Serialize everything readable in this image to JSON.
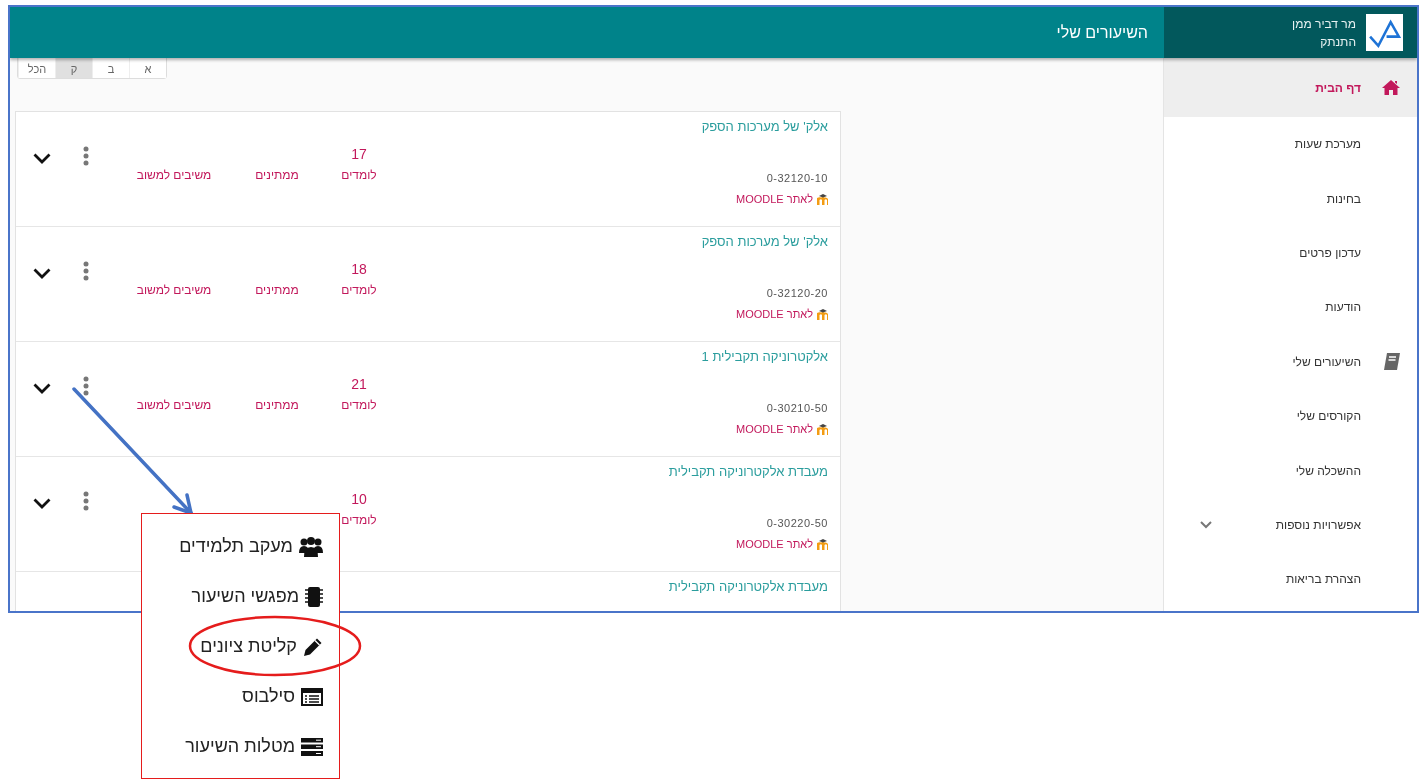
{
  "header": {
    "title": "השיעורים שלי",
    "user_name": "מר דביר ממן",
    "logout": "התנתק"
  },
  "filter_tabs": [
    {
      "label": "א",
      "selected": false
    },
    {
      "label": "ב",
      "selected": false
    },
    {
      "label": "ק",
      "selected": true
    },
    {
      "label": "הכל",
      "selected": false
    }
  ],
  "sidebar": {
    "items": [
      {
        "label": "דף הבית",
        "selected": true,
        "kind": "home"
      },
      {
        "label": "מערכת שעות",
        "selected": false,
        "kind": "plain"
      },
      {
        "label": "בחינות",
        "selected": false,
        "kind": "plain"
      },
      {
        "label": "עדכון פרטים",
        "selected": false,
        "kind": "plain"
      },
      {
        "label": "הודעות",
        "selected": false,
        "kind": "plain"
      },
      {
        "label": "השיעורים שלי",
        "selected": false,
        "kind": "book"
      },
      {
        "label": "הקורסים שלי",
        "selected": false,
        "kind": "plain"
      },
      {
        "label": "ההשכלה שלי",
        "selected": false,
        "kind": "plain"
      },
      {
        "label": "אפשרויות נוספות",
        "selected": false,
        "kind": "group",
        "expanded": false
      },
      {
        "label": "הצהרת בריאות",
        "selected": false,
        "kind": "plain"
      }
    ]
  },
  "courses": [
    {
      "title": "אלק' של מערכות הספק",
      "code": "0-32120-10",
      "moodle_link": "לאתר MOODLE",
      "students_count": "17",
      "students_label": "לומדים",
      "pending_label": "ממתינים",
      "feedback_label": "משיבים למשוב"
    },
    {
      "title": "אלק' של מערכות הספק",
      "code": "0-32120-20",
      "moodle_link": "לאתר MOODLE",
      "students_count": "18",
      "students_label": "לומדים",
      "pending_label": "ממתינים",
      "feedback_label": "משיבים למשוב"
    },
    {
      "title": "אלקטרוניקה תקבילית 1",
      "code": "0-30210-50",
      "moodle_link": "לאתר MOODLE",
      "students_count": "21",
      "students_label": "לומדים",
      "pending_label": "ממתינים",
      "feedback_label": "משיבים למשוב"
    },
    {
      "title": "מעבדת אלקטרוניקה תקבילית",
      "code": "0-30220-50",
      "moodle_link": "לאתר MOODLE",
      "students_count": "10",
      "students_label": "לומדים"
    },
    {
      "title": "מעבדת אלקטרוניקה תקבילית"
    }
  ],
  "context_menu": {
    "items": [
      {
        "label": "מעקב תלמידים",
        "kind": "group",
        "highlighted": false
      },
      {
        "label": "מפגשי השיעור",
        "kind": "chip",
        "highlighted": false
      },
      {
        "label": "קליטת ציונים",
        "kind": "pencil",
        "highlighted": true
      },
      {
        "label": "סילבוס",
        "kind": "list",
        "highlighted": false
      },
      {
        "label": "מטלות השיעור",
        "kind": "tasks",
        "highlighted": false
      }
    ]
  }
}
